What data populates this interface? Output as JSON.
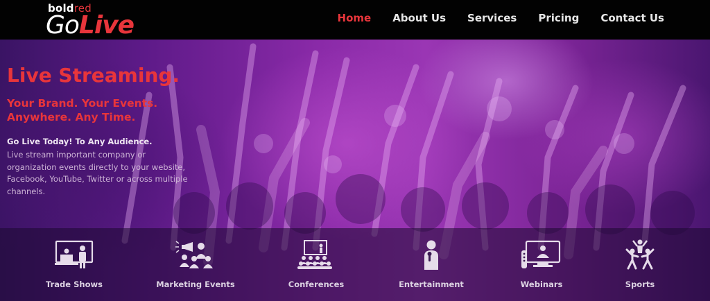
{
  "brand": {
    "small_white": "bold",
    "small_red": "red",
    "big_white": "Go",
    "big_red": "Live",
    "accent_color": "#e8353b"
  },
  "nav": {
    "items": [
      {
        "label": "Home",
        "active": true
      },
      {
        "label": "About Us",
        "active": false
      },
      {
        "label": "Services",
        "active": false
      },
      {
        "label": "Pricing",
        "active": false
      },
      {
        "label": "Contact Us",
        "active": false
      }
    ]
  },
  "hero": {
    "headline": "Live Streaming.",
    "subline1": "Your Brand. Your Events.",
    "subline2": "Anywhere. Any Time.",
    "tagline": "Go Live Today! To Any Audience.",
    "description": "Live stream important company or organization events directly to your website, Facebook, YouTube, Twitter or across multiple channels."
  },
  "services": [
    {
      "label": "Trade Shows",
      "icon": "trade-show-booth-icon"
    },
    {
      "label": "Marketing Events",
      "icon": "megaphone-audience-icon"
    },
    {
      "label": "Conferences",
      "icon": "conference-audience-icon"
    },
    {
      "label": "Entertainment",
      "icon": "singer-microphone-icon"
    },
    {
      "label": "Webinars",
      "icon": "webinar-screen-icon"
    },
    {
      "label": "Sports",
      "icon": "cheering-athletes-icon"
    }
  ]
}
